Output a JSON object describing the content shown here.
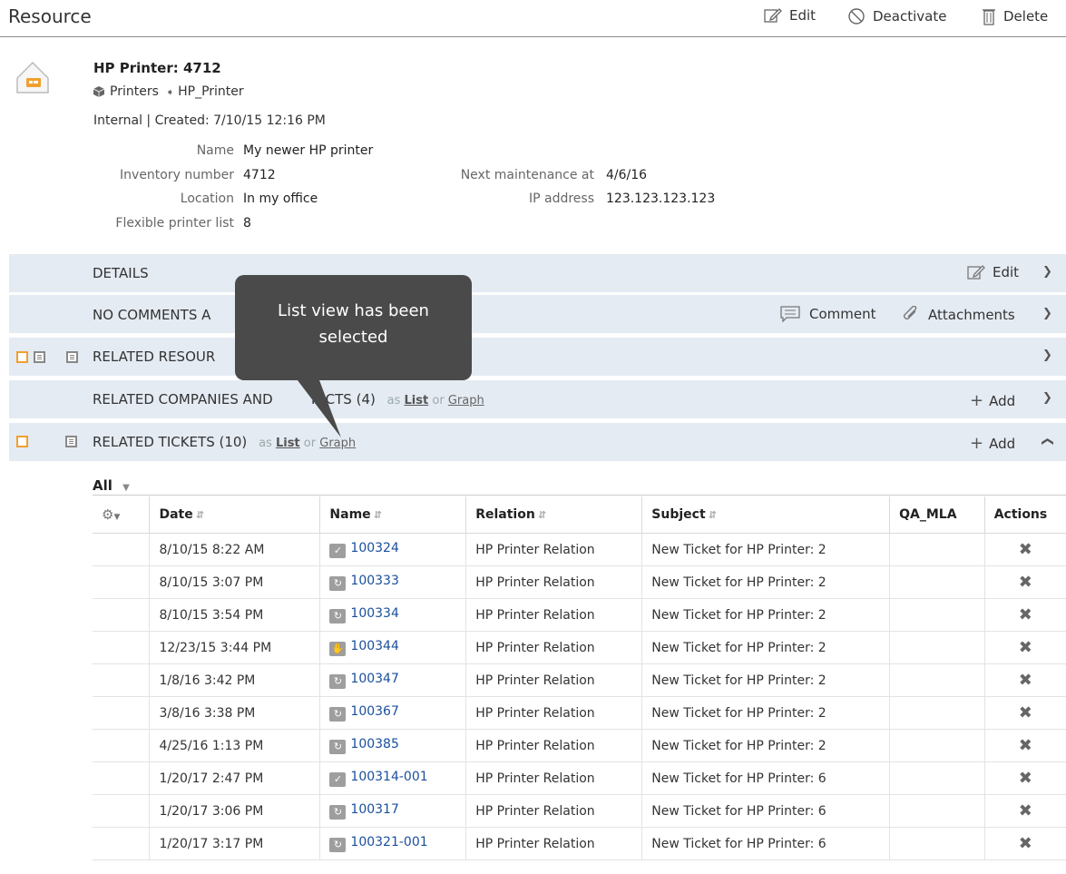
{
  "header": {
    "title": "Resource",
    "edit": "Edit",
    "deactivate": "Deactivate",
    "delete": "Delete"
  },
  "resource": {
    "name": "HP Printer: 4712",
    "category": "Printers",
    "type": "HP_Printer",
    "meta": "Internal | Created: 7/10/15 12:16 PM",
    "fields": {
      "name_label": "Name",
      "name_value": "My newer HP printer",
      "inv_label": "Inventory number",
      "inv_value": "4712",
      "loc_label": "Location",
      "loc_value": "In my office",
      "flex_label": "Flexible printer list",
      "flex_value": "8",
      "maint_label": "Next maintenance at",
      "maint_value": "4/6/16",
      "ip_label": "IP address",
      "ip_value": "123.123.123.123"
    }
  },
  "sections": {
    "details": {
      "title": "DETAILS",
      "edit": "Edit"
    },
    "comments": {
      "title": "NO COMMENTS A",
      "comment": "Comment",
      "attachments": "Attachments"
    },
    "resources": {
      "title": "RELATED RESOUR"
    },
    "companies": {
      "title": "RELATED COMPANIES AND",
      "title_tail": "TACTS (4)",
      "as": "as",
      "list": "List",
      "or": "or",
      "graph": "Graph",
      "add": "Add"
    },
    "tickets": {
      "title": "RELATED TICKETS (10)",
      "as": "as",
      "list": "List",
      "or": "or",
      "graph": "Graph",
      "add": "Add"
    }
  },
  "tooltip": {
    "line1": "List view has been",
    "line2": "selected"
  },
  "filter": {
    "value": "All"
  },
  "table": {
    "columns": [
      "Date",
      "Name",
      "Relation",
      "Subject",
      "QA_MLA",
      "Actions"
    ],
    "rows": [
      {
        "date": "8/10/15 8:22 AM",
        "icon": "check-icon",
        "name": "100324",
        "relation": "HP Printer Relation",
        "subject": "New Ticket for HP Printer: 2"
      },
      {
        "date": "8/10/15 3:07 PM",
        "icon": "refresh-icon",
        "name": "100333",
        "relation": "HP Printer Relation",
        "subject": "New Ticket for HP Printer: 2"
      },
      {
        "date": "8/10/15 3:54 PM",
        "icon": "refresh-icon",
        "name": "100334",
        "relation": "HP Printer Relation",
        "subject": "New Ticket for HP Printer: 2"
      },
      {
        "date": "12/23/15 3:44 PM",
        "icon": "hand-icon",
        "name": "100344",
        "relation": "HP Printer Relation",
        "subject": "New Ticket for HP Printer: 2"
      },
      {
        "date": "1/8/16 3:42 PM",
        "icon": "refresh-icon",
        "name": "100347",
        "relation": "HP Printer Relation",
        "subject": "New Ticket for HP Printer: 2"
      },
      {
        "date": "3/8/16 3:38 PM",
        "icon": "refresh-icon",
        "name": "100367",
        "relation": "HP Printer Relation",
        "subject": "New Ticket for HP Printer: 2"
      },
      {
        "date": "4/25/16 1:13 PM",
        "icon": "refresh-icon",
        "name": "100385",
        "relation": "HP Printer Relation",
        "subject": "New Ticket for HP Printer: 2"
      },
      {
        "date": "1/20/17 2:47 PM",
        "icon": "check-icon",
        "name": "100314-001",
        "relation": "HP Printer Relation",
        "subject": "New Ticket for HP Printer: 6"
      },
      {
        "date": "1/20/17 3:06 PM",
        "icon": "refresh-icon",
        "name": "100317",
        "relation": "HP Printer Relation",
        "subject": "New Ticket for HP Printer: 6"
      },
      {
        "date": "1/20/17 3:17 PM",
        "icon": "refresh-icon",
        "name": "100321-001",
        "relation": "HP Printer Relation",
        "subject": "New Ticket for HP Printer: 6"
      }
    ]
  }
}
